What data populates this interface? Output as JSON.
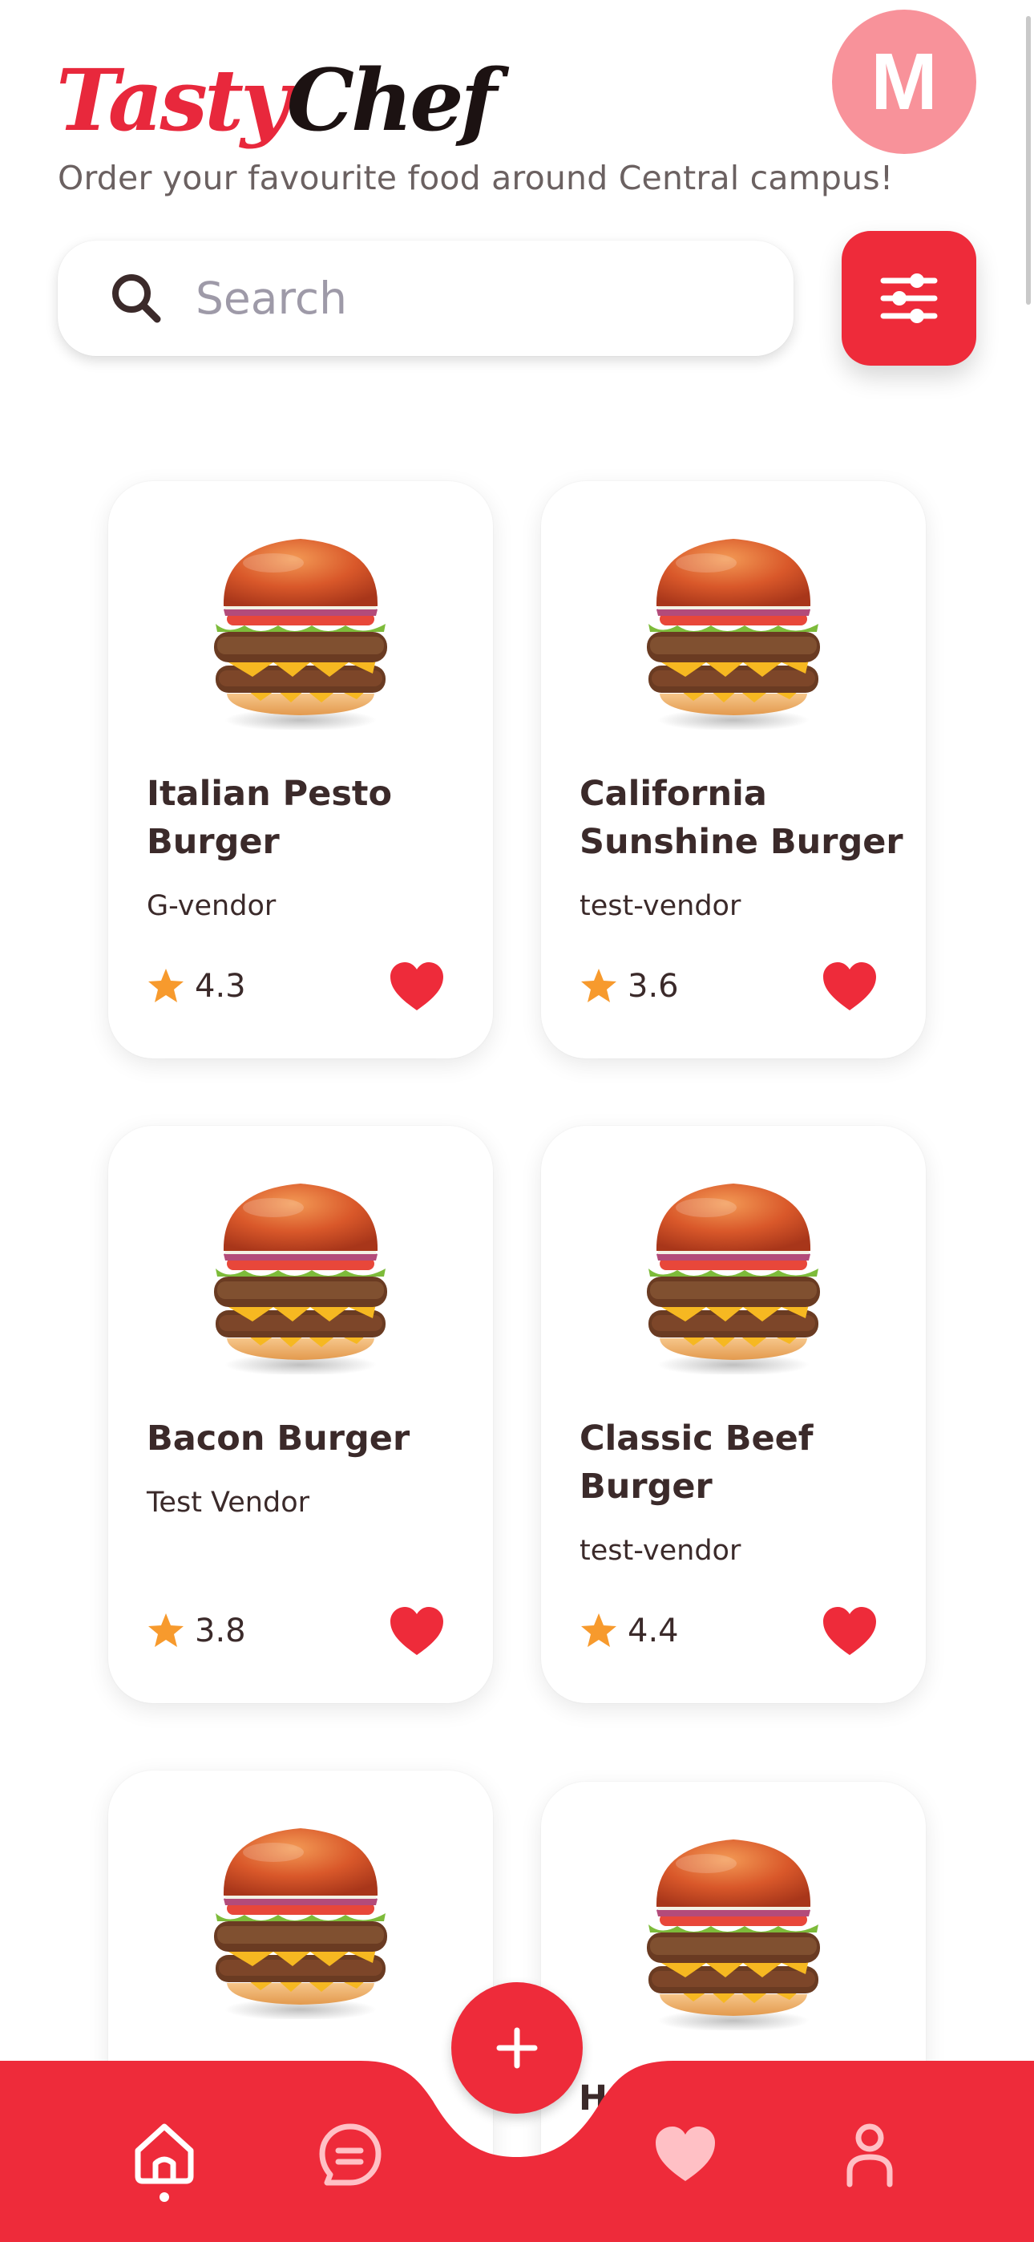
{
  "header": {
    "brand_part1": "Tasty",
    "brand_part2": "Chef",
    "avatar_initial": "M",
    "tagline": "Order your favourite food around Central campus!"
  },
  "search": {
    "placeholder": "Search",
    "value": ""
  },
  "cards": [
    {
      "name": "Italian Pesto Burger",
      "vendor": "G-vendor",
      "rating": "4.3",
      "favorited": true
    },
    {
      "name": "California Sunshine Burger",
      "vendor": "test-vendor",
      "rating": "3.6",
      "favorited": true
    },
    {
      "name": "Bacon Burger",
      "vendor": "Test Vendor",
      "rating": "3.8",
      "favorited": true
    },
    {
      "name": "Classic Beef Burger",
      "vendor": "test-vendor",
      "rating": "4.4",
      "favorited": true
    }
  ],
  "partial_card_text": "H",
  "bottom_nav": {
    "items": [
      {
        "icon": "home-icon",
        "active": true
      },
      {
        "icon": "chat-icon",
        "active": false
      },
      {
        "icon": "heart-icon",
        "active": false
      },
      {
        "icon": "person-icon",
        "active": false
      }
    ],
    "fab_icon": "plus-icon"
  },
  "colors": {
    "brand_red": "#ee2b3a",
    "avatar_pink": "#f8929a",
    "star_orange": "#f79a2d",
    "text_dark": "#3b2a2a"
  }
}
